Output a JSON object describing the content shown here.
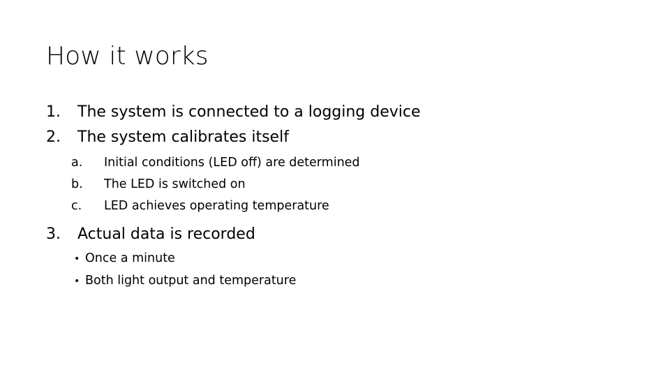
{
  "slide": {
    "title": "How it works",
    "background_color": "#ffffff",
    "text_color": "#000000"
  },
  "outline": {
    "items": [
      {
        "marker": "1.",
        "text": "The system is connected to a logging device"
      },
      {
        "marker": "2.",
        "text": "The system calibrates itself",
        "sub_items": [
          {
            "marker": "a.",
            "text": "Initial conditions (LED off) are determined"
          },
          {
            "marker": "b.",
            "text": "The LED is switched on"
          },
          {
            "marker": "c.",
            "text": "LED achieves operating temperature"
          }
        ]
      },
      {
        "marker": "3.",
        "text": "Actual data is recorded",
        "bullets": [
          {
            "marker": "•",
            "text": "Once a minute"
          },
          {
            "marker": "•",
            "text": "Both light output and temperature"
          }
        ]
      }
    ]
  }
}
